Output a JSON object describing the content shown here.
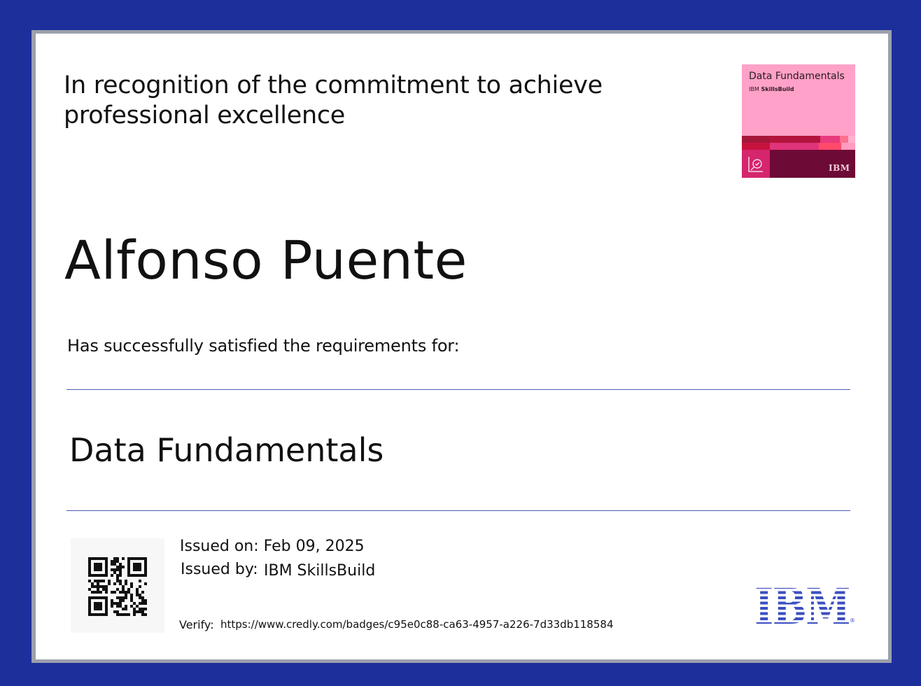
{
  "certificate": {
    "recognition_text": "In recognition of the commitment to achieve professional excellence",
    "recipient_name": "Alfonso Puente",
    "requirement_text": "Has successfully satisfied the requirements for:",
    "course_title": "Data Fundamentals"
  },
  "issuance": {
    "issued_on_label": "Issued on:",
    "issued_on_value": "Feb 09, 2025",
    "issued_by_label": "Issued by:",
    "issued_by_value": "IBM SkillsBuild",
    "verify_label": "Verify:",
    "verify_url": "https://www.credly.com/badges/c95e0c88-ca63-4957-a226-7d33db118584"
  },
  "badge": {
    "title": "Data Fundamentals",
    "brand": "IBM",
    "product": "SkillsBuild",
    "corner_logo": "IBM",
    "icon": "analytics-magnifier-icon"
  },
  "branding": {
    "logo": "IBM",
    "background_color": "#1c2f9a",
    "rule_color": "#4d5fb0",
    "badge_color": "#ffa1c8",
    "ibm_blue": "#3b4fc0"
  }
}
